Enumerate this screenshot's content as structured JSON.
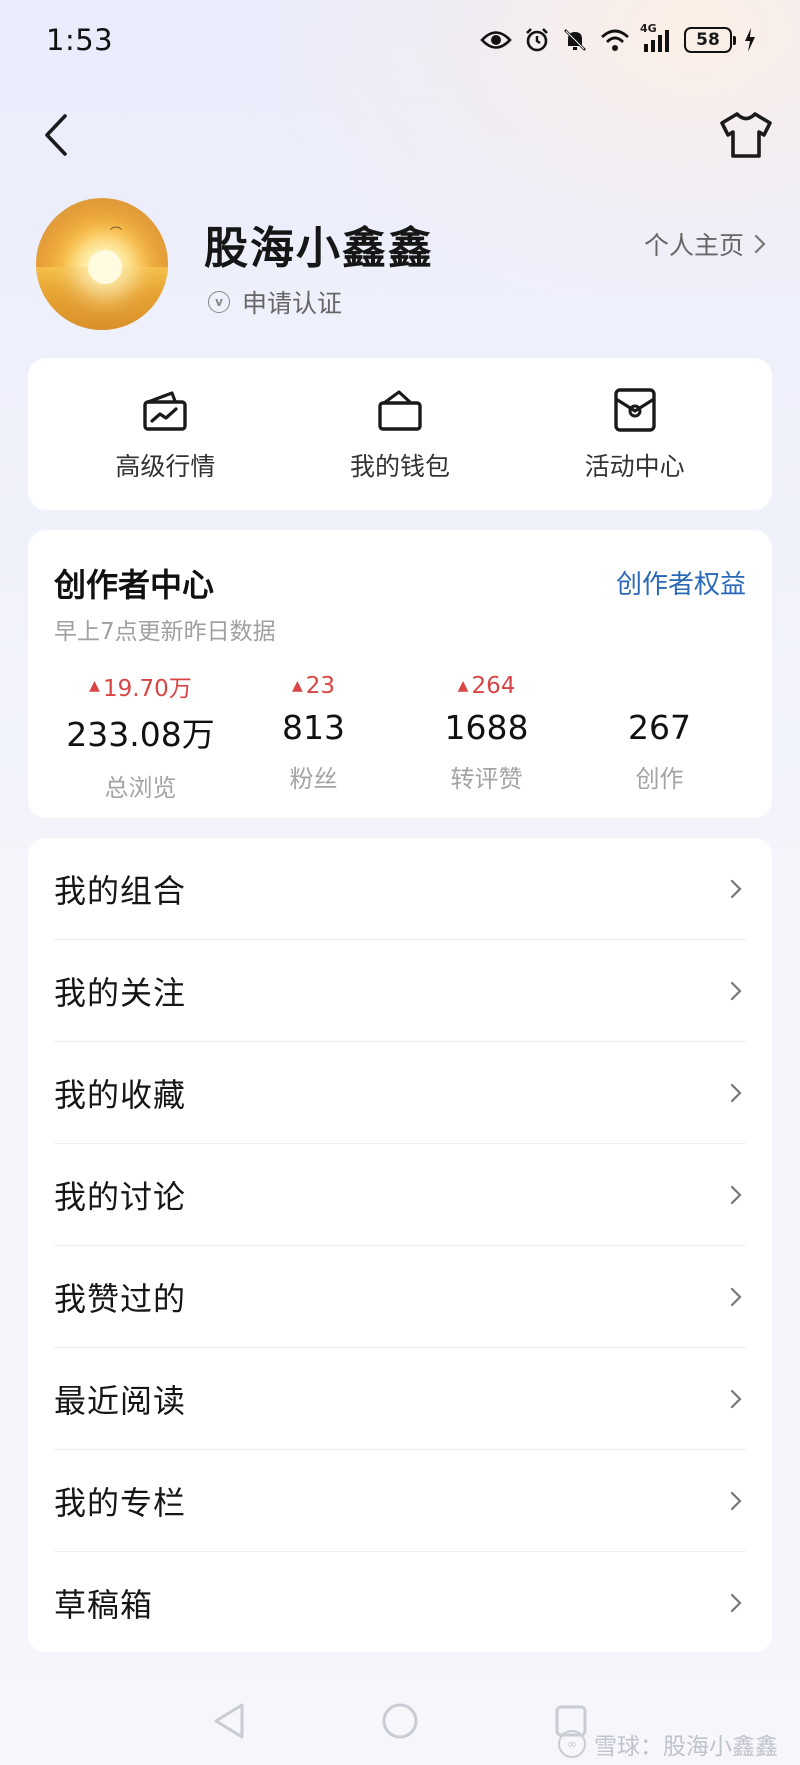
{
  "status_bar": {
    "time": "1:53",
    "network": "4G",
    "battery": "58",
    "icons": [
      "eye-icon",
      "alarm-icon",
      "bell-off-icon",
      "wifi-icon",
      "signal-icon",
      "battery-icon",
      "charging-icon"
    ]
  },
  "header": {
    "back_icon": "back-arrow-icon",
    "theme_icon": "tshirt-icon"
  },
  "profile": {
    "username": "股海小鑫鑫",
    "verify_label": "申请认证",
    "verify_badge": "v",
    "homepage_label": "个人主页"
  },
  "quick_actions": [
    {
      "label": "高级行情",
      "icon": "chart-box-icon"
    },
    {
      "label": "我的钱包",
      "icon": "wallet-icon"
    },
    {
      "label": "活动中心",
      "icon": "gift-box-icon"
    }
  ],
  "creator": {
    "title": "创作者中心",
    "link": "创作者权益",
    "subtitle": "早上7点更新昨日数据",
    "stats": [
      {
        "delta": "19.70万",
        "value": "233.08万",
        "label": "总浏览"
      },
      {
        "delta": "23",
        "value": "813",
        "label": "粉丝"
      },
      {
        "delta": "264",
        "value": "1688",
        "label": "转评赞"
      },
      {
        "delta": "",
        "value": "267",
        "label": "创作"
      }
    ],
    "up_color": "#d94545"
  },
  "menu": [
    {
      "label": "我的组合"
    },
    {
      "label": "我的关注"
    },
    {
      "label": "我的收藏"
    },
    {
      "label": "我的讨论"
    },
    {
      "label": "我赞过的"
    },
    {
      "label": "最近阅读"
    },
    {
      "label": "我的专栏"
    },
    {
      "label": "草稿箱"
    }
  ],
  "watermark": "雪球：股海小鑫鑫",
  "colors": {
    "accent_link": "#2a68b8",
    "up": "#d94545"
  }
}
